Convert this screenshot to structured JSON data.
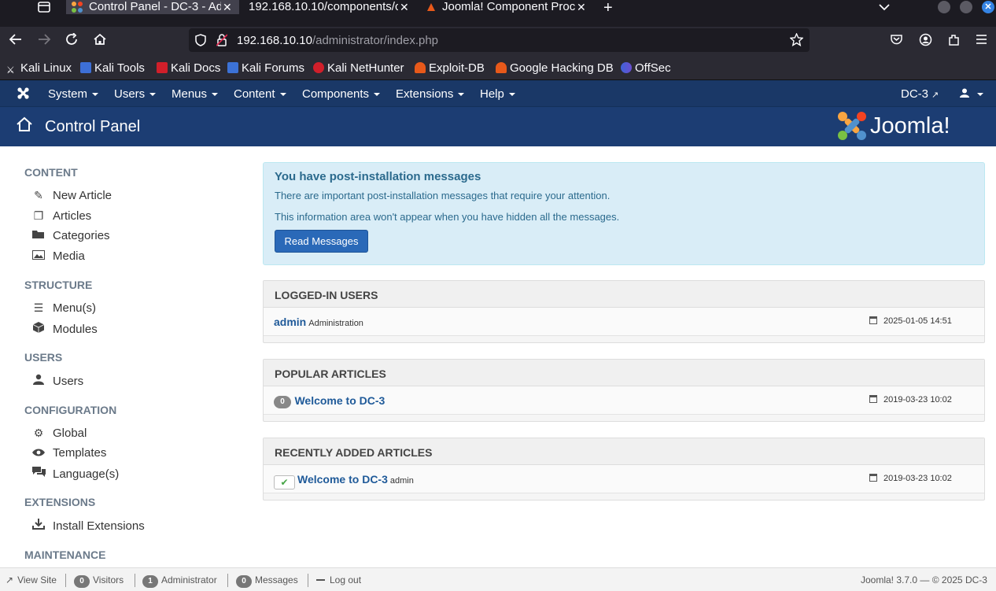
{
  "browser": {
    "tabs": [
      {
        "title": "Control Panel - DC-3 - Ad",
        "active": true
      },
      {
        "title": "192.168.10.10/components/c",
        "active": false
      },
      {
        "title": "Joomla! Component Proc",
        "active": false
      }
    ],
    "url_host": "192.168.10.10",
    "url_path": "/administrator/index.php",
    "bookmarks": [
      "Kali Linux",
      "Kali Tools",
      "Kali Docs",
      "Kali Forums",
      "Kali NetHunter",
      "Exploit-DB",
      "Google Hacking DB",
      "OffSec"
    ]
  },
  "topnav": {
    "menus": [
      "System",
      "Users",
      "Menus",
      "Content",
      "Components",
      "Extensions",
      "Help"
    ],
    "site": "DC-3"
  },
  "header": {
    "title": "Control Panel",
    "logo_text": "Joomla!"
  },
  "sidebar": {
    "content_heading": "CONTENT",
    "new_article": "New Article",
    "articles": "Articles",
    "categories": "Categories",
    "media": "Media",
    "structure_heading": "STRUCTURE",
    "menus": "Menu(s)",
    "modules": "Modules",
    "users_heading": "USERS",
    "users": "Users",
    "configuration_heading": "CONFIGURATION",
    "global": "Global",
    "templates": "Templates",
    "languages": "Language(s)",
    "extensions_heading": "EXTENSIONS",
    "install_extensions": "Install Extensions",
    "maintenance_heading": "MAINTENANCE"
  },
  "alert": {
    "heading": "You have post-installation messages",
    "line1": "There are important post-installation messages that require your attention.",
    "line2": "This information area won't appear when you have hidden all the messages.",
    "button": "Read Messages"
  },
  "logged_in": {
    "heading": "LOGGED-IN USERS",
    "user": "admin",
    "role": "Administration",
    "date": "2025-01-05 14:51"
  },
  "popular": {
    "heading": "POPULAR ARTICLES",
    "hits": "0",
    "title": "Welcome to DC-3",
    "date": "2019-03-23 10:02"
  },
  "recent": {
    "heading": "RECENTLY ADDED ARTICLES",
    "title": "Welcome to DC-3",
    "author": "admin",
    "date": "2019-03-23 10:02"
  },
  "footer": {
    "view_site": "View Site",
    "visitors_count": "0",
    "visitors": "Visitors",
    "admin_count": "1",
    "administrator": "Administrator",
    "messages_count": "0",
    "messages": "Messages",
    "logout": "Log out",
    "version": "Joomla! 3.7.0",
    "copyright": "© 2025 DC-3",
    "dash": "—"
  }
}
